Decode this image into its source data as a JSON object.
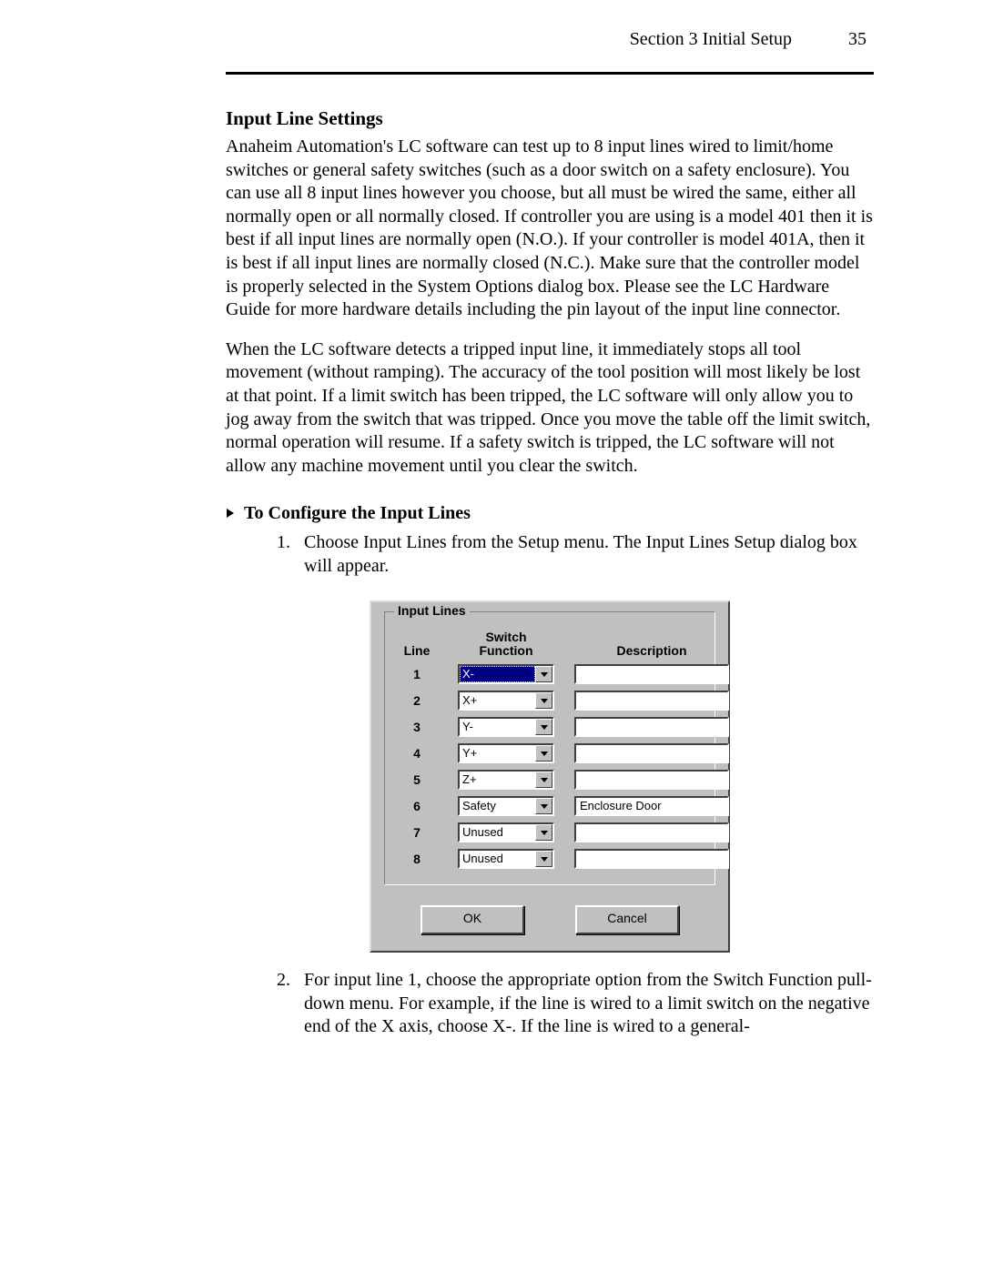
{
  "header": {
    "section": "Section 3 Initial Setup",
    "page_no": "35"
  },
  "title": "Input Line Settings",
  "para1": "Anaheim Automation's LC software can test up to 8 input lines wired to limit/home switches or general safety switches (such as a door switch on a safety enclosure).  You can use all 8 input lines however you choose, but all must be wired the same, either all normally open or all normally closed.  If controller you are using is a model 401 then it is best if all input lines are normally open (N.O.).  If your controller is model 401A, then it is best if all input lines are normally closed (N.C.).  Make sure that the controller model is properly selected in the System Options dialog box.  Please see the LC Hardware Guide for more hardware details including the pin layout of the input line connector.",
  "para2": "When the LC software detects a tripped input line, it immediately stops all tool movement (without ramping). The accuracy of the tool position will most likely be lost at that point.  If a limit switch has been tripped, the LC software will only allow you to jog away from the switch that was tripped.  Once you move the table off the limit switch, normal operation will resume.  If a safety switch is tripped, the LC software will not allow any machine movement until you clear the switch.",
  "subheading": "To Configure the Input Lines",
  "step1_num": "1.",
  "step1": "Choose Input Lines from the Setup menu.  The Input Lines Setup dialog box will appear.",
  "step2_num": "2.",
  "step2": "For input line 1, choose the appropriate option from the Switch Function pull-down menu.  For example, if the line is wired to a limit switch on the negative end of the X axis, choose X-.  If the line is wired to a general-",
  "dialog": {
    "group_label": "Input Lines",
    "col_line": "Line",
    "col_func1": "Switch",
    "col_func2": "Function",
    "col_desc": "Description",
    "ok": "OK",
    "cancel": "Cancel",
    "rows": [
      {
        "line": "1",
        "func": "X-",
        "desc": "",
        "focused": true
      },
      {
        "line": "2",
        "func": "X+",
        "desc": "",
        "focused": false
      },
      {
        "line": "3",
        "func": "Y-",
        "desc": "",
        "focused": false
      },
      {
        "line": "4",
        "func": "Y+",
        "desc": "",
        "focused": false
      },
      {
        "line": "5",
        "func": "Z+",
        "desc": "",
        "focused": false
      },
      {
        "line": "6",
        "func": "Safety",
        "desc": "Enclosure Door",
        "focused": false
      },
      {
        "line": "7",
        "func": "Unused",
        "desc": "",
        "focused": false
      },
      {
        "line": "8",
        "func": "Unused",
        "desc": "",
        "focused": false
      }
    ]
  }
}
